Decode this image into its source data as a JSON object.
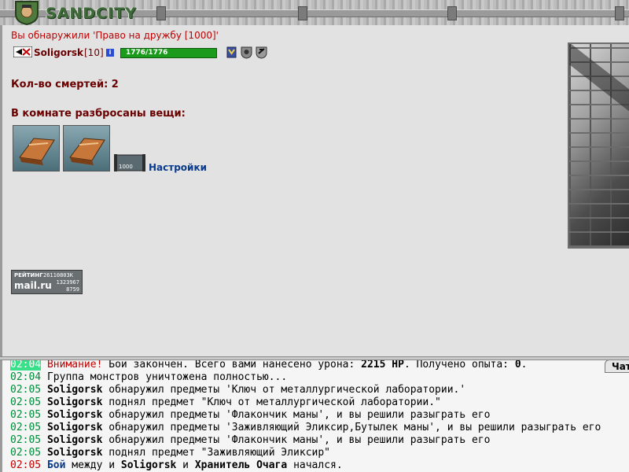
{
  "app": {
    "logo_text": "SANDCITY"
  },
  "event": {
    "found_text": "Вы обнаружили 'Право на дружбу [1000]'"
  },
  "user": {
    "nick": "Soligorsk",
    "level": "[10]",
    "info_icon": "i",
    "hp_text": "1776/1776",
    "hp_fraction": 1.0
  },
  "stats": {
    "deaths": "Кол-во смертей: 2"
  },
  "items": {
    "title": "В комнате разбросаны вещи:",
    "scroll_label": "1000",
    "settings_link": "Настройки"
  },
  "counter": {
    "label": "РЕЙТИНГ",
    "val1": "26110803K",
    "logo": "mail.ru",
    "val2": "1323967",
    "val3": "8759"
  },
  "chat": {
    "tab_label": "Чат",
    "lines": [
      {
        "time": "02:04",
        "s1": "Внимание!",
        "s2": " Бой закончен. Всего вами нанесено урона: ",
        "s3": "2215 HP",
        "s4": ". Получено опыта: ",
        "s5": "0",
        "s6": "."
      },
      {
        "time": "02:04",
        "text": "Группа монстров уничтожена полностью..."
      },
      {
        "time": "02:05",
        "nick": "Soligorsk",
        "text": " обнаружил предметы 'Ключ от металлургической лаборатории.'"
      },
      {
        "time": "02:05",
        "nick": "Soligorsk",
        "text": " поднял предмет \"Ключ от металлургической лаборатории.\""
      },
      {
        "time": "02:05",
        "nick": "Soligorsk",
        "text": " обнаружил предметы 'Флакончик маны', и вы решили разыграть его"
      },
      {
        "time": "02:05",
        "nick": "Soligorsk",
        "text": " обнаружил предметы 'Заживляющий Эликсир,Бутылек маны', и вы решили разыграть его"
      },
      {
        "time": "02:05",
        "nick": "Soligorsk",
        "text": " обнаружил предметы 'Флакончик маны', и вы решили разыграть его"
      },
      {
        "time": "02:05",
        "nick": "Soligorsk",
        "text": " поднял предмет \"Заживляющий Эликсир\""
      },
      {
        "time": "02:05",
        "w1": "Бой",
        "w2": " между и ",
        "w3": "Soligorsk",
        "w4": " и ",
        "w5": "Хранитель Очага",
        "w6": " начался."
      }
    ]
  },
  "colors": {
    "accent_red": "#c00000",
    "nick_red": "#6a0000",
    "hp_green": "#1b9a1b",
    "link_blue": "#0a3a8c",
    "time_green": "#008a3a",
    "time_highlight": "#38e08a"
  }
}
